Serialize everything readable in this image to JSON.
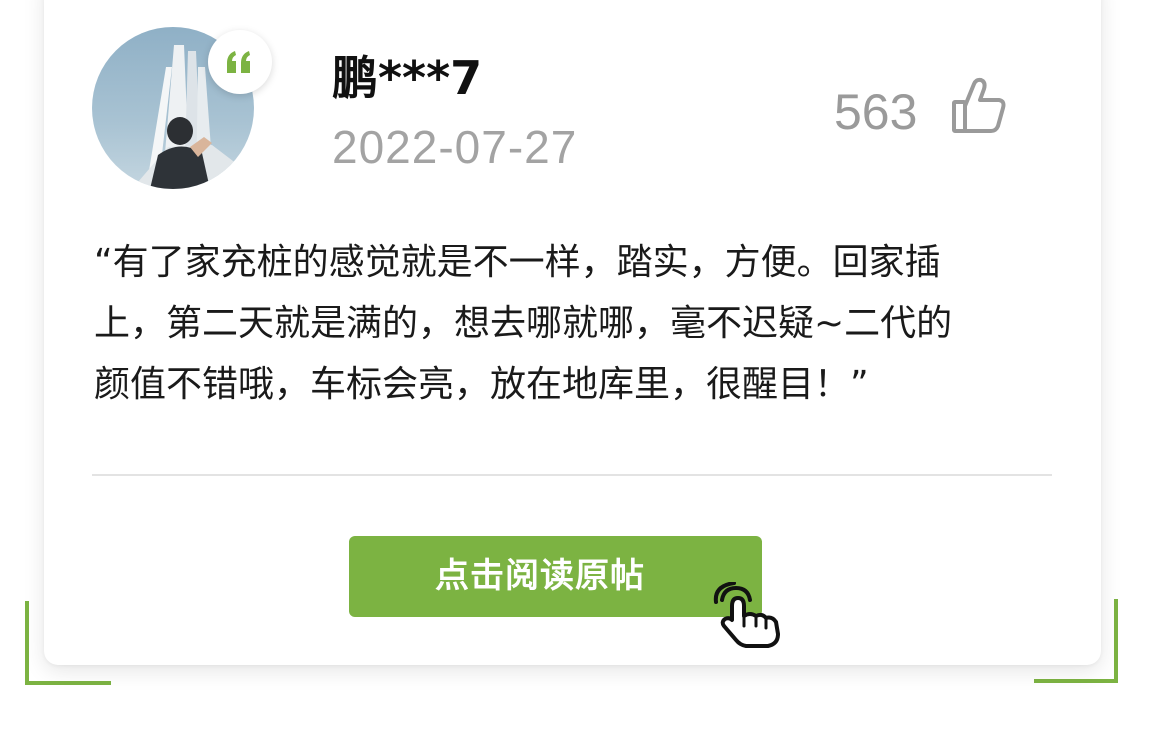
{
  "review": {
    "username": "鹏***7",
    "date": "2022-07-27",
    "likes": "563",
    "text_lines": [
      "“有了家充桩的感觉就是不一样，踏实，方便。回家插",
      "上，第二天就是满的，想去哪就哪，毫不迟疑~二代的",
      "颜值不错哦，车标会亮，放在地库里，很醒目！”"
    ]
  },
  "actions": {
    "read_original_label": "点击阅读原帖"
  },
  "colors": {
    "accent": "#7cb342",
    "muted_text": "#a3a3a3",
    "body_text": "#1a1a1a",
    "divider": "#e3e3e3"
  },
  "icons": {
    "quote": "quote-icon",
    "like": "thumbs-up-icon",
    "pointer": "hand-pointer-icon"
  }
}
